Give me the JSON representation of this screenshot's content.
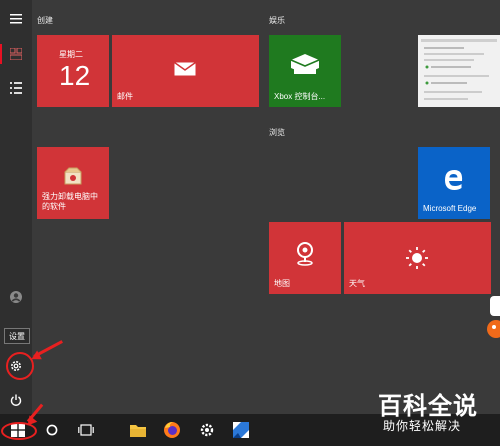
{
  "sections": {
    "create": "创建",
    "entertainment": "娱乐",
    "browse": "浏览"
  },
  "tiles": {
    "calendar": {
      "weekday": "星期二",
      "day": "12"
    },
    "mail": {
      "label": "邮件"
    },
    "xbox": {
      "label": "Xbox 控制台..."
    },
    "uninstall": {
      "label": "强力卸载电脑中\n的软件"
    },
    "edge": {
      "label": "Microsoft Edge"
    },
    "maps": {
      "label": "地图"
    },
    "weather": {
      "label": "天气"
    }
  },
  "tooltip": {
    "settings": "设置"
  },
  "watermark": {
    "title": "百科全说",
    "subtitle": "助你轻松解决"
  },
  "icons": {
    "hamburger": "hamburger-menu-icon",
    "tiles": "all-tiles-icon",
    "list": "all-apps-list-icon",
    "user": "user-icon",
    "settings": "gear-icon",
    "power": "power-icon",
    "start": "windows-logo-icon"
  },
  "colors": {
    "tile_red": "#d13438",
    "xbox_green": "#1f7a1f",
    "edge_blue": "#0a63c8",
    "annotation_red": "#e82020"
  }
}
